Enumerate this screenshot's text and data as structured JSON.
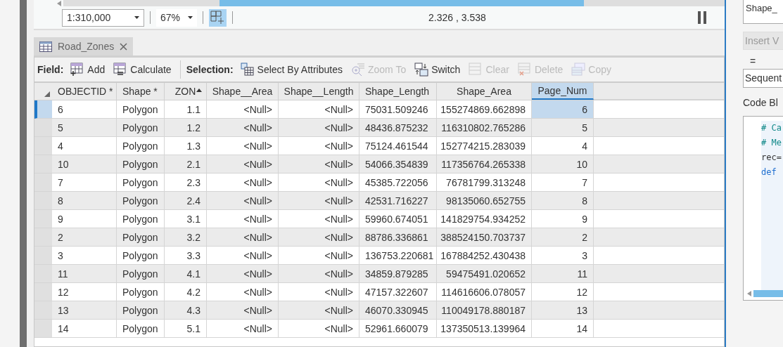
{
  "map_status": {
    "scale": "1:310,000",
    "zoom": "67%",
    "grid_toggle_on": true,
    "coordinates": "2.326 , 3.538"
  },
  "tabs": [
    {
      "label": "Road_Zones",
      "selected": true
    }
  ],
  "toolbar": {
    "groups": [
      {
        "label": "Field:",
        "items": [
          {
            "label": "Add",
            "disabled": false
          },
          {
            "label": "Calculate",
            "disabled": false
          }
        ]
      },
      {
        "label": "Selection:",
        "items": [
          {
            "label": "Select By Attributes",
            "disabled": false
          },
          {
            "label": "Zoom To",
            "disabled": true
          },
          {
            "label": "Switch",
            "disabled": false
          },
          {
            "label": "Clear",
            "disabled": true
          },
          {
            "label": "Delete",
            "disabled": true
          },
          {
            "label": "Copy",
            "disabled": true
          }
        ]
      }
    ]
  },
  "table": {
    "columns": [
      {
        "label": "OBJECTID *",
        "sorted": false,
        "selected": false
      },
      {
        "label": "Shape *",
        "sorted": false,
        "selected": false
      },
      {
        "label": "ZON",
        "sorted": true,
        "selected": false
      },
      {
        "label": "Shape__Area",
        "sorted": false,
        "selected": false
      },
      {
        "label": "Shape__Length",
        "sorted": false,
        "selected": false
      },
      {
        "label": "Shape_Length",
        "sorted": false,
        "selected": false
      },
      {
        "label": "Shape_Area",
        "sorted": false,
        "selected": false
      },
      {
        "label": "Page_Num",
        "sorted": false,
        "selected": true
      }
    ],
    "rows": [
      {
        "selected": true,
        "cells": [
          "6",
          "Polygon",
          "1.1",
          "<Null>",
          "<Null>",
          "75031.509246",
          "155274869.662898",
          "6"
        ]
      },
      {
        "selected": false,
        "cells": [
          "5",
          "Polygon",
          "1.2",
          "<Null>",
          "<Null>",
          "48436.875232",
          "116310802.765286",
          "5"
        ]
      },
      {
        "selected": false,
        "cells": [
          "4",
          "Polygon",
          "1.3",
          "<Null>",
          "<Null>",
          "75124.461544",
          "152774215.283039",
          "4"
        ]
      },
      {
        "selected": false,
        "cells": [
          "10",
          "Polygon",
          "2.1",
          "<Null>",
          "<Null>",
          "54066.354839",
          "117356764.265338",
          "10"
        ]
      },
      {
        "selected": false,
        "cells": [
          "7",
          "Polygon",
          "2.3",
          "<Null>",
          "<Null>",
          "45385.722056",
          "76781799.313248",
          "7"
        ]
      },
      {
        "selected": false,
        "cells": [
          "8",
          "Polygon",
          "2.4",
          "<Null>",
          "<Null>",
          "42531.716227",
          "98135060.652755",
          "8"
        ]
      },
      {
        "selected": false,
        "cells": [
          "9",
          "Polygon",
          "3.1",
          "<Null>",
          "<Null>",
          "59960.674051",
          "141829754.934252",
          "9"
        ]
      },
      {
        "selected": false,
        "cells": [
          "2",
          "Polygon",
          "3.2",
          "<Null>",
          "<Null>",
          "88786.336861",
          "388524150.703737",
          "2"
        ]
      },
      {
        "selected": false,
        "cells": [
          "3",
          "Polygon",
          "3.3",
          "<Null>",
          "<Null>",
          "136753.220681",
          "167884252.430438",
          "3"
        ]
      },
      {
        "selected": false,
        "cells": [
          "11",
          "Polygon",
          "4.1",
          "<Null>",
          "<Null>",
          "34859.879285",
          "59475491.020652",
          "11"
        ]
      },
      {
        "selected": false,
        "cells": [
          "12",
          "Polygon",
          "4.2",
          "<Null>",
          "<Null>",
          "47157.322607",
          "114616606.078057",
          "12"
        ]
      },
      {
        "selected": false,
        "cells": [
          "13",
          "Polygon",
          "4.3",
          "<Null>",
          "<Null>",
          "46070.330945",
          "110049178.880187",
          "13"
        ]
      },
      {
        "selected": false,
        "cells": [
          "14",
          "Polygon",
          "5.1",
          "<Null>",
          "<Null>",
          "52961.660079",
          "137350513.139964",
          "14"
        ]
      }
    ]
  },
  "calculate_pane": {
    "fields_list": [
      "Shape_"
    ],
    "insert_button": {
      "label": "Insert V",
      "disabled": true
    },
    "equals": "=",
    "expression": "Sequent",
    "code_block_label": "Code Bl",
    "code_lines": [
      {
        "text": "# Ca",
        "kind": "comment"
      },
      {
        "text": "# Me",
        "kind": "comment"
      },
      {
        "text": "rec=",
        "kind": "plain"
      },
      {
        "text": "def",
        "kind": "keyword"
      }
    ]
  }
}
